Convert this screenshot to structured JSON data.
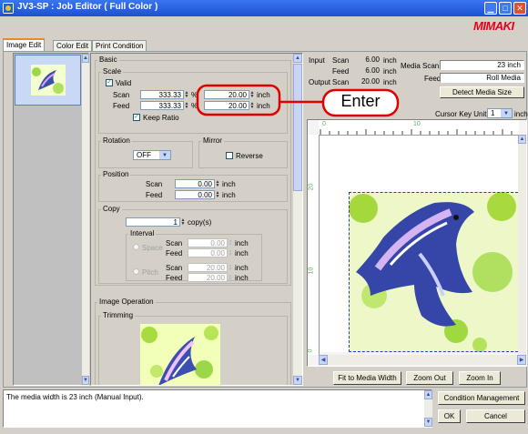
{
  "window": {
    "title": "JV3-SP : Job Editor ( Full Color )",
    "brand": "MIMAKI"
  },
  "tabs": [
    "Image Edit",
    "Color Edit",
    "Print Condition"
  ],
  "basic": {
    "section_label": "Basic",
    "scale_label": "Scale",
    "valid_label": "Valid",
    "scan_label": "Scan",
    "scan_percent": "333.33",
    "scan_length": "20.00",
    "feed_label": "Feed",
    "feed_percent": "333.33",
    "feed_length": "20.00",
    "percent_unit": "%",
    "inch_unit": "inch",
    "keep_ratio_label": "Keep Ratio"
  },
  "rotation": {
    "label": "Rotation",
    "value": "OFF"
  },
  "mirror": {
    "label": "Mirror",
    "reverse_label": "Reverse"
  },
  "position": {
    "label": "Position",
    "scan_label": "Scan",
    "scan_value": "0.00",
    "feed_label": "Feed",
    "feed_value": "0.00",
    "unit": "inch"
  },
  "copy": {
    "label": "Copy",
    "count": "1",
    "count_unit": "copy(s)",
    "interval_label": "Interval",
    "space_label": "Space",
    "pitch_label": "Pitch",
    "scan_label": "Scan",
    "feed_label": "Feed",
    "space_scan": "0.00",
    "space_feed": "0.00",
    "pitch_scan": "20.00",
    "pitch_feed": "20.00",
    "unit": "inch"
  },
  "image_operation": {
    "label": "Image Operation",
    "trimming_label": "Trimming"
  },
  "info": {
    "input_label": "Input",
    "output_label": "Output",
    "scan_label": "Scan",
    "feed_label": "Feed",
    "input_scan": "6.00",
    "input_feed": "6.00",
    "output_scan": "20.00",
    "unit": "inch",
    "media_scan_label": "Media Scan",
    "media_scan_value": "23 inch",
    "media_feed_label": "Feed",
    "media_feed_value": "Roll Media",
    "detect_button": "Detect Media Size",
    "cursor_key_unit_label": "Cursor Key Unit",
    "cursor_key_unit_value": "1",
    "cursor_key_unit_suffix": "inch"
  },
  "ruler": {
    "top_labels": [
      "0",
      "10"
    ],
    "left_labels": [
      "20",
      "10",
      "0"
    ]
  },
  "preview_buttons": {
    "fit": "Fit to Media Width",
    "zoom_out": "Zoom Out",
    "zoom_in": "Zoom In"
  },
  "status": {
    "message": "The media width is 23 inch (Manual Input)."
  },
  "bottom_buttons": {
    "condition": "Condition Management",
    "ok": "OK",
    "cancel": "Cancel"
  },
  "callout": {
    "text": "Enter"
  },
  "colors": {
    "title_bar": "#2a5bd6",
    "brand_red": "#e0001a",
    "callout_red": "#e00000",
    "selection_dash": "#1a3fd0"
  }
}
